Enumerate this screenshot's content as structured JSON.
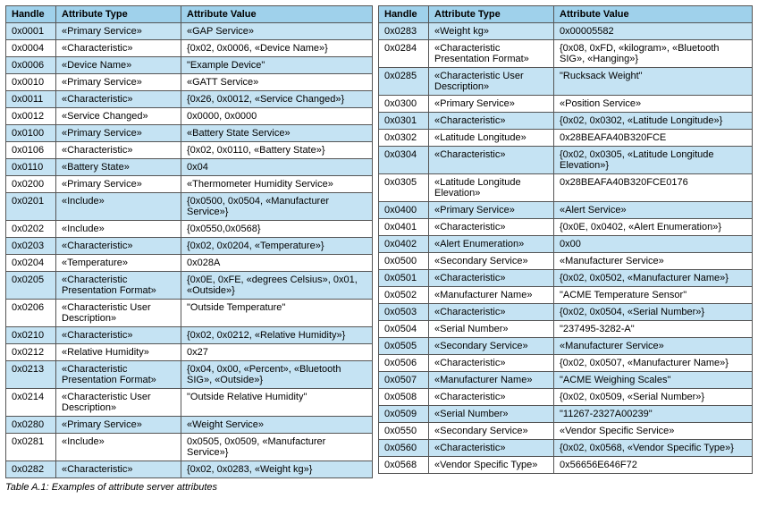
{
  "caption": "Table A.1:  Examples of attribute server attributes",
  "headers": {
    "handle": "Handle",
    "type": "Attribute Type",
    "value": "Attribute Value"
  },
  "left": {
    "col_value_w": 214,
    "rows": [
      {
        "h": "0x0001",
        "t": "«Primary Service»",
        "v": "«GAP Service»"
      },
      {
        "h": "0x0004",
        "t": "«Characteristic»",
        "v": "{0x02, 0x0006, «Device Name»}"
      },
      {
        "h": "0x0006",
        "t": "«Device Name»",
        "v": "\"Example Device\""
      },
      {
        "h": "0x0010",
        "t": "«Primary Service»",
        "v": "«GATT Service»"
      },
      {
        "h": "0x0011",
        "t": "«Characteristic»",
        "v": "{0x26, 0x0012, «Service Changed»}"
      },
      {
        "h": "0x0012",
        "t": "«Service Changed»",
        "v": "0x0000, 0x0000"
      },
      {
        "h": "0x0100",
        "t": "«Primary Service»",
        "v": "«Battery State Service»"
      },
      {
        "h": "0x0106",
        "t": "«Characteristic»",
        "v": "{0x02, 0x0110, «Battery State»}"
      },
      {
        "h": "0x0110",
        "t": "«Battery State»",
        "v": "0x04"
      },
      {
        "h": "0x0200",
        "t": "«Primary Service»",
        "v": "«Thermometer Humidity Service»"
      },
      {
        "h": "0x0201",
        "t": "«Include»",
        "v": "{0x0500, 0x0504, «Manufacturer Service»}"
      },
      {
        "h": "0x0202",
        "t": "«Include»",
        "v": "{0x0550,0x0568}"
      },
      {
        "h": "0x0203",
        "t": "«Characteristic»",
        "v": "{0x02, 0x0204, «Temperature»}"
      },
      {
        "h": "0x0204",
        "t": "«Temperature»",
        "v": "0x028A"
      },
      {
        "h": "0x0205",
        "t": "«Characteristic Presentation Format»",
        "v": "{0x0E, 0xFE, «degrees Celsius», 0x01, «Outside»}"
      },
      {
        "h": "0x0206",
        "t": "«Characteristic User Description»",
        "v": "\"Outside Temperature\""
      },
      {
        "h": "0x0210",
        "t": "«Characteristic»",
        "v": "{0x02, 0x0212, «Relative Humidity»}"
      },
      {
        "h": "0x0212",
        "t": "«Relative Humidity»",
        "v": "0x27"
      },
      {
        "h": "0x0213",
        "t": "«Characteristic Presentation Format»",
        "v": "{0x04, 0x00, «Percent», «Bluetooth SIG», «Outside»}"
      },
      {
        "h": "0x0214",
        "t": "«Characteristic User Description»",
        "v": "\"Outside Relative Humidity\""
      },
      {
        "h": "0x0280",
        "t": "«Primary Service»",
        "v": "«Weight Service»"
      },
      {
        "h": "0x0281",
        "t": "«Include»",
        "v": "0x0505, 0x0509, «Manufacturer Service»}"
      },
      {
        "h": "0x0282",
        "t": "«Characteristic»",
        "v": "{0x02, 0x0283, «Weight kg»}"
      }
    ]
  },
  "right": {
    "col_value_w": 222,
    "rows": [
      {
        "h": "0x0283",
        "t": "«Weight kg»",
        "v": "0x00005582"
      },
      {
        "h": "0x0284",
        "t": "«Characteristic Presentation Format»",
        "v": "{0x08, 0xFD, «kilogram», «Bluetooth SIG», «Hanging»}"
      },
      {
        "h": "0x0285",
        "t": "«Characteristic User Description»",
        "v": "\"Rucksack Weight\""
      },
      {
        "h": "0x0300",
        "t": "«Primary Service»",
        "v": "«Position Service»"
      },
      {
        "h": "0x0301",
        "t": "«Characteristic»",
        "v": "{0x02, 0x0302, «Latitude Longitude»}"
      },
      {
        "h": "0x0302",
        "t": "«Latitude Longitude»",
        "v": "0x28BEAFA40B320FCE"
      },
      {
        "h": "0x0304",
        "t": "«Characteristic»",
        "v": "{0x02, 0x0305, «Latitude Longitude Elevation»}"
      },
      {
        "h": "0x0305",
        "t": "«Latitude Longitude Elevation»",
        "v": "0x28BEAFA40B320FCE0176"
      },
      {
        "h": "0x0400",
        "t": "«Primary Service»",
        "v": "«Alert Service»"
      },
      {
        "h": "0x0401",
        "t": "«Characteristic»",
        "v": "{0x0E, 0x0402, «Alert Enumeration»}"
      },
      {
        "h": "0x0402",
        "t": "«Alert Enumeration»",
        "v": "0x00"
      },
      {
        "h": "0x0500",
        "t": "«Secondary Service»",
        "v": "«Manufacturer Service»"
      },
      {
        "h": "0x0501",
        "t": "«Characteristic»",
        "v": "{0x02, 0x0502, «Manufacturer Name»}"
      },
      {
        "h": "0x0502",
        "t": "«Manufacturer Name»",
        "v": "\"ACME Temperature Sensor\""
      },
      {
        "h": "0x0503",
        "t": "«Characteristic»",
        "v": "{0x02, 0x0504, «Serial Number»}"
      },
      {
        "h": "0x0504",
        "t": "«Serial Number»",
        "v": "\"237495-3282-A\""
      },
      {
        "h": "0x0505",
        "t": "«Secondary Service»",
        "v": "«Manufacturer Service»"
      },
      {
        "h": "0x0506",
        "t": "«Characteristic»",
        "v": "{0x02, 0x0507, «Manufacturer Name»}"
      },
      {
        "h": "0x0507",
        "t": "«Manufacturer Name»",
        "v": "\"ACME Weighing Scales\""
      },
      {
        "h": "0x0508",
        "t": "«Characteristic»",
        "v": "{0x02, 0x0509, «Serial Number»}"
      },
      {
        "h": "0x0509",
        "t": "«Serial Number»",
        "v": "\"11267-2327A00239\""
      },
      {
        "h": "0x0550",
        "t": "«Secondary Service»",
        "v": "«Vendor Specific Service»"
      },
      {
        "h": "0x0560",
        "t": "«Characteristic»",
        "v": "{0x02, 0x0568, «Vendor Specific Type»}"
      },
      {
        "h": "0x0568",
        "t": "«Vendor Specific Type»",
        "v": "0x56656E646F72"
      }
    ]
  }
}
